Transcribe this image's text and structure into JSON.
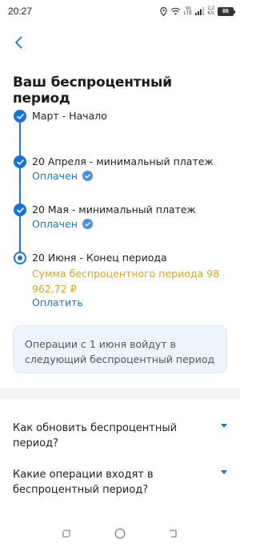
{
  "status_bar": {
    "time": "20:27",
    "network_label_top": "Vo",
    "network_label_bottom": "LTE",
    "speed_top": "2,2",
    "speed_bottom": "K/s",
    "battery": "86"
  },
  "header": {
    "back_icon": "chevron-left-icon",
    "title": "Ваш беспроцентный период"
  },
  "timeline": {
    "steps": [
      {
        "label": "Март - Начало",
        "status": "",
        "done": true
      },
      {
        "label": "20 Апреля - минимальный платеж",
        "status": "Оплачен",
        "done": true
      },
      {
        "label": "20 Мая - минимальный платеж",
        "status": "Оплачен",
        "done": true
      },
      {
        "label": "20 Июня - Конец периода",
        "amount": "Сумма беспроцентного периода 98 962,72 ₽",
        "action": "Оплатить",
        "done": false
      }
    ]
  },
  "info_card": {
    "text": "Операции с 1 июня войдут в следующий беспроцентный период"
  },
  "faq": {
    "items": [
      {
        "question": "Как обновить беспроцентный период?"
      },
      {
        "question": "Какие операции входят в беспроцентный период?"
      }
    ]
  },
  "colors": {
    "accent": "#1a73d9",
    "amount": "#e0a321",
    "info_bg": "#eef4fc"
  },
  "nav_bar": {
    "icons": [
      "recent-apps-icon",
      "home-icon",
      "back-icon"
    ]
  }
}
